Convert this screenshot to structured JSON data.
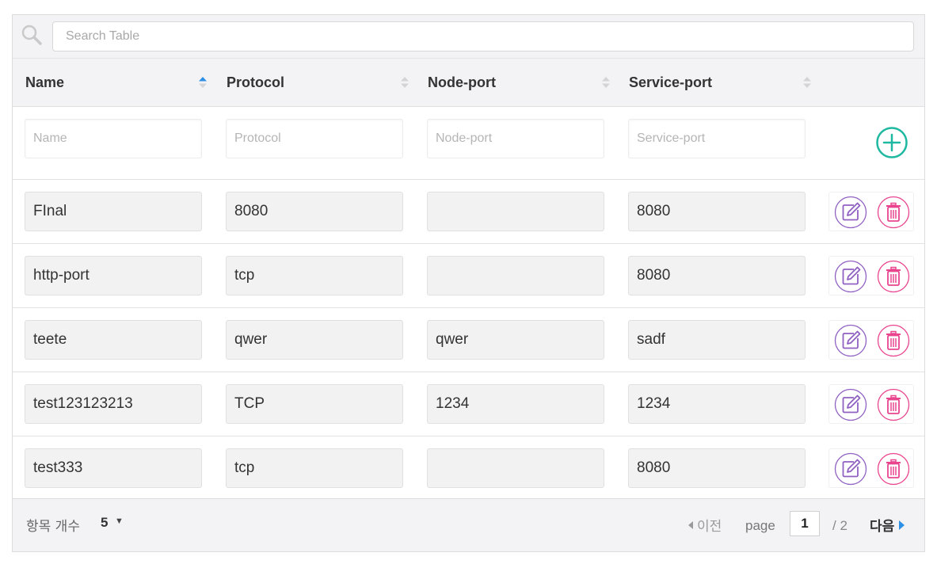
{
  "search": {
    "placeholder": "Search Table"
  },
  "columns": [
    {
      "label": "Name",
      "sort": "ascending"
    },
    {
      "label": "Protocol",
      "sort": "none"
    },
    {
      "label": "Node-port",
      "sort": "none"
    },
    {
      "label": "Service-port",
      "sort": "none"
    }
  ],
  "add_row": {
    "name_placeholder": "Name",
    "protocol_placeholder": "Protocol",
    "nodeport_placeholder": "Node-port",
    "serviceport_placeholder": "Service-port"
  },
  "rows": [
    {
      "name": "FInal",
      "protocol": "8080",
      "node_port": "",
      "service_port": "8080"
    },
    {
      "name": "http-port",
      "protocol": "tcp",
      "node_port": "",
      "service_port": "8080"
    },
    {
      "name": "teete",
      "protocol": "qwer",
      "node_port": "qwer",
      "service_port": "sadf"
    },
    {
      "name": "test123123213",
      "protocol": "TCP",
      "node_port": "1234",
      "service_port": "1234"
    },
    {
      "name": "test333",
      "protocol": "tcp",
      "node_port": "",
      "service_port": "8080"
    }
  ],
  "footer": {
    "page_size_label": "항목 개수",
    "page_size_value": "5",
    "prev_label": "이전",
    "page_label": "page",
    "current_page": "1",
    "total_pages": "/ 2",
    "next_label": "다음"
  },
  "icons": {
    "search": "search-icon",
    "sort": "sort-icon",
    "add": "plus-circle-icon",
    "edit": "edit-icon",
    "delete": "trash-icon"
  },
  "colors": {
    "sort_active": "#2d8fe6",
    "add": "#1fb8a0",
    "edit": "#9061c2",
    "delete": "#e9458f",
    "next_arrow": "#2d8fe6"
  }
}
